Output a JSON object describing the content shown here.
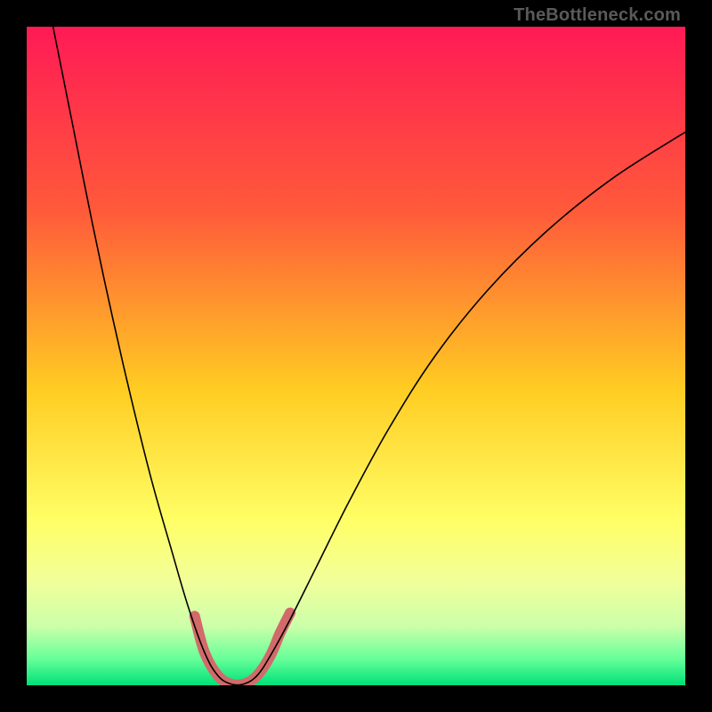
{
  "watermark": "TheBottleneck.com",
  "chart_data": {
    "type": "line",
    "title": "",
    "xlabel": "",
    "ylabel": "",
    "xlim": [
      0,
      100
    ],
    "ylim": [
      0,
      100
    ],
    "background_gradient": {
      "stops": [
        {
          "offset": 0,
          "color": "#ff1a55"
        },
        {
          "offset": 28,
          "color": "#ff5a3a"
        },
        {
          "offset": 55,
          "color": "#ffcc22"
        },
        {
          "offset": 75,
          "color": "#ffff66"
        },
        {
          "offset": 84,
          "color": "#f2ff99"
        },
        {
          "offset": 91,
          "color": "#ccffaa"
        },
        {
          "offset": 96,
          "color": "#66ff99"
        },
        {
          "offset": 100,
          "color": "#00e078"
        }
      ]
    },
    "series": [
      {
        "name": "bottleneck-curve",
        "stroke": "#000000",
        "stroke_width": 1.6,
        "points": [
          {
            "x": 4.0,
            "y": 100.0
          },
          {
            "x": 7.0,
            "y": 85.0
          },
          {
            "x": 10.0,
            "y": 70.0
          },
          {
            "x": 13.0,
            "y": 56.0
          },
          {
            "x": 16.0,
            "y": 43.0
          },
          {
            "x": 19.0,
            "y": 31.0
          },
          {
            "x": 22.0,
            "y": 20.5
          },
          {
            "x": 24.5,
            "y": 12.0
          },
          {
            "x": 27.0,
            "y": 5.0
          },
          {
            "x": 29.0,
            "y": 1.5
          },
          {
            "x": 31.0,
            "y": 0.2
          },
          {
            "x": 33.0,
            "y": 0.2
          },
          {
            "x": 35.0,
            "y": 1.5
          },
          {
            "x": 37.0,
            "y": 4.5
          },
          {
            "x": 40.0,
            "y": 10.0
          },
          {
            "x": 44.0,
            "y": 18.0
          },
          {
            "x": 49.0,
            "y": 28.0
          },
          {
            "x": 55.0,
            "y": 39.0
          },
          {
            "x": 62.0,
            "y": 50.0
          },
          {
            "x": 70.0,
            "y": 60.0
          },
          {
            "x": 79.0,
            "y": 69.0
          },
          {
            "x": 89.0,
            "y": 77.0
          },
          {
            "x": 100.0,
            "y": 84.0
          }
        ]
      },
      {
        "name": "highlight-u",
        "stroke": "#d36a6a",
        "stroke_width": 12,
        "points": [
          {
            "x": 25.5,
            "y": 10.5
          },
          {
            "x": 27.0,
            "y": 5.0
          },
          {
            "x": 29.0,
            "y": 1.5
          },
          {
            "x": 31.0,
            "y": 0.2
          },
          {
            "x": 33.0,
            "y": 0.2
          },
          {
            "x": 35.0,
            "y": 1.5
          },
          {
            "x": 37.0,
            "y": 4.5
          },
          {
            "x": 38.5,
            "y": 8.0
          },
          {
            "x": 40.0,
            "y": 11.0
          }
        ]
      }
    ]
  }
}
